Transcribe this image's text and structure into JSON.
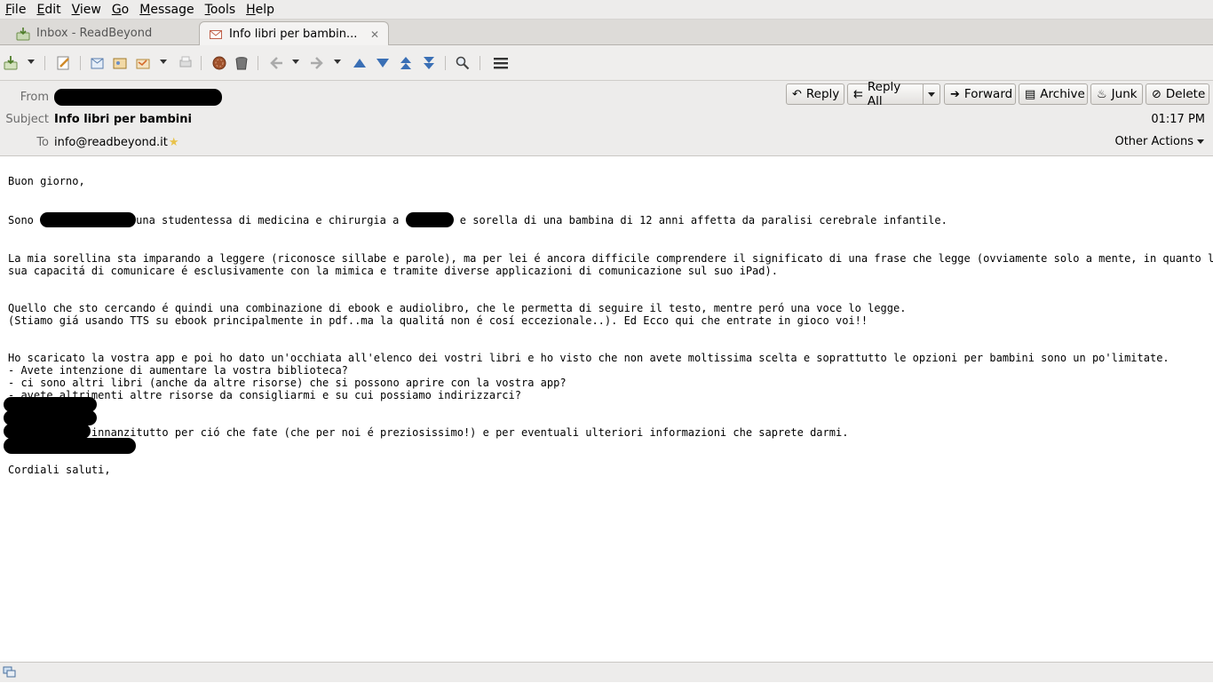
{
  "menu": [
    {
      "first": "F",
      "rest": "ile"
    },
    {
      "first": "E",
      "rest": "dit"
    },
    {
      "first": "V",
      "rest": "iew"
    },
    {
      "first": "G",
      "rest": "o"
    },
    {
      "first": "M",
      "rest": "essage"
    },
    {
      "first": "T",
      "rest": "ools"
    },
    {
      "first": "H",
      "rest": "elp"
    }
  ],
  "tabs": {
    "inbox": "Inbox - ReadBeyond",
    "message": "Info libri per bambin..."
  },
  "header": {
    "from_label": "From",
    "subject_label": "Subject",
    "subject": "Info libri per bambini",
    "to_label": "To",
    "to": "info@readbeyond.it",
    "time": "01:17 PM",
    "other_actions": "Other Actions",
    "actions": {
      "reply": "Reply",
      "reply_all": "Reply All",
      "forward": "Forward",
      "archive": "Archive",
      "junk": "Junk",
      "delete": "Delete"
    }
  },
  "body": {
    "greeting": "Buon giorno,",
    "p1_a": "Sono ",
    "p1_b": "una studentessa di medicina e chirurgia a ",
    "p1_c": " e sorella di una bambina di 12 anni affetta da paralisi cerebrale infantile.",
    "p2_l1": "La mia sorellina sta imparando a leggere (riconosce sillabe e parole), ma per lei é ancora difficile comprendere il significato di una frase che legge (ovviamente solo a mente, in quanto la",
    "p2_l2": "sua capacitá di comunicare é esclusivamente con la mimica e tramite diverse applicazioni di comunicazione sul suo iPad).",
    "p3_l1": "Quello che sto cercando é quindi una combinazione di ebook e audiolibro, che le permetta di seguire il testo, mentre peró una voce lo legge.",
    "p3_l2": "(Stiamo giá usando TTS su ebook principalmente in pdf..ma la qualitá non é cosí eccezionale..). Ed Ecco qui che entrate in gioco voi!!",
    "p4_l1": "Ho scaricato la vostra app e poi ho dato un'occhiata all'elenco dei vostri libri e ho visto che non avete moltissima scelta e soprattutto le opzioni per bambini sono un po'limitate.",
    "p4_l2": "- Avete intenzione di aumentare la vostra biblioteca?",
    "p4_l3": "- ci sono altri libri (anche da altre risorse) che si possono aprire con la vostra app?",
    "p4_l4": "- avete altrimenti altre risorse da consigliarmi e su cui possiamo indirizzarci?",
    "p5": "Vi ringrazio innanzitutto per ció che fate (che per noi é preziosissimo!) e per eventuali ulteriori informazioni che saprete darmi.",
    "closing": "Cordiali saluti,"
  },
  "colors": {
    "accent_blue": "#3a6fb5",
    "redaction": "#000000"
  }
}
